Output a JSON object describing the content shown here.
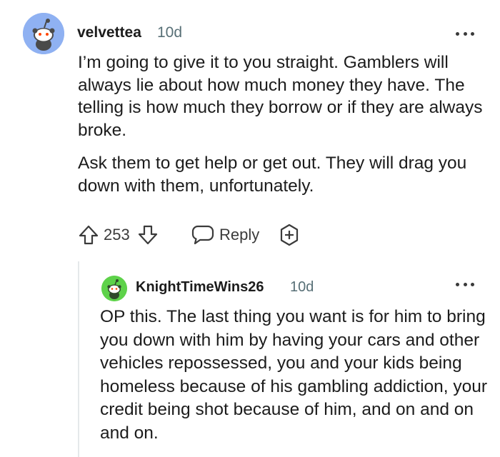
{
  "comments": [
    {
      "username": "velvettea",
      "age": "10d",
      "paragraphs": [
        "I’m going to give it to you straight. Gamblers will always lie about how much money they have. The telling is how much they borrow or if they are always broke.",
        "Ask them to get help or get out. They will drag you down with them, unfortunately."
      ],
      "score": "253",
      "reply_label": "Reply",
      "avatar_color": "#8fb1f2"
    },
    {
      "username": "KnightTimeWins26",
      "age": "10d",
      "paragraphs": [
        "OP this. The last thing you want is for him to bring you down with him by having your cars and other vehicles repossessed, you and your kids being homeless because of his gambling addiction, your credit being shot because of him, and on and on and on."
      ],
      "avatar_color": "#5ed24a"
    }
  ],
  "icons": {
    "more": "more-options-icon",
    "upvote": "upvote-arrow-icon",
    "downvote": "downvote-arrow-icon",
    "reply": "speech-bubble-icon",
    "award": "award-plus-icon",
    "avatar": "snoo-avatar-icon"
  }
}
